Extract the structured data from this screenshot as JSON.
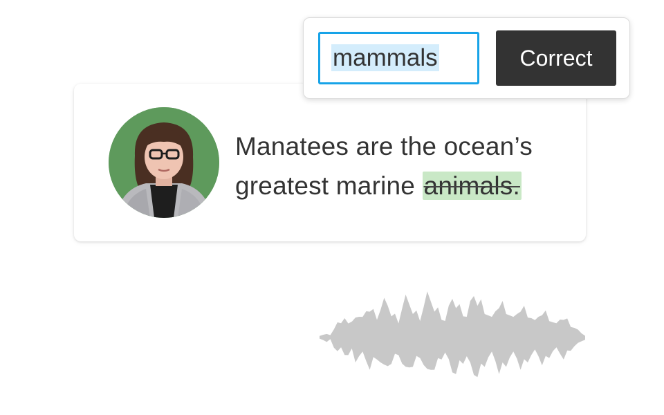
{
  "transcript": {
    "text_before": "Manatees are the ocean’s greatest marine ",
    "edited_word": "animals."
  },
  "correction": {
    "input_value": "mammals",
    "button_label": "Correct"
  },
  "colors": {
    "avatar_background": "#5e9a5c",
    "edited_highlight": "#c9e8c6",
    "input_border": "#17a3e8",
    "selection_highlight": "#d4edfc",
    "button_background": "#333333",
    "waveform": "#c8c8c8"
  },
  "icons": {
    "waveform": "audio-waveform-icon",
    "avatar": "speaker-avatar"
  }
}
